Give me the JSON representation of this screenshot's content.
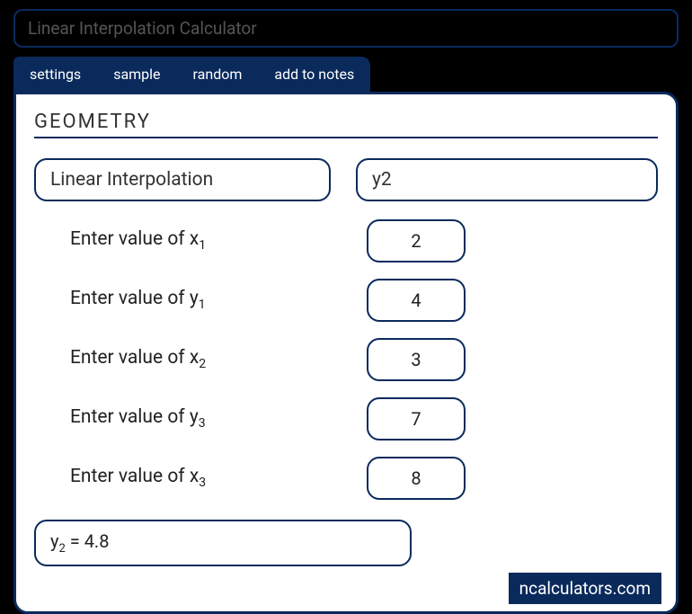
{
  "title": "Linear Interpolation Calculator",
  "tabs": {
    "settings": "settings",
    "sample": "sample",
    "random": "random",
    "add_to_notes": "add to notes"
  },
  "section": "GEOMETRY",
  "selectors": {
    "method": "Linear Interpolation",
    "target": "y2"
  },
  "inputs": {
    "x1": {
      "label_prefix": "Enter value of x",
      "label_sub": "1",
      "value": "2"
    },
    "y1": {
      "label_prefix": "Enter value of y",
      "label_sub": "1",
      "value": "4"
    },
    "x2": {
      "label_prefix": "Enter value of x",
      "label_sub": "2",
      "value": "3"
    },
    "y3": {
      "label_prefix": "Enter value of y",
      "label_sub": "3",
      "value": "7"
    },
    "x3": {
      "label_prefix": "Enter value of x",
      "label_sub": "3",
      "value": "8"
    }
  },
  "result": {
    "var": "y",
    "sub": "2",
    "equals": "  =  ",
    "value": "4.8"
  },
  "watermark": "ncalculators.com"
}
